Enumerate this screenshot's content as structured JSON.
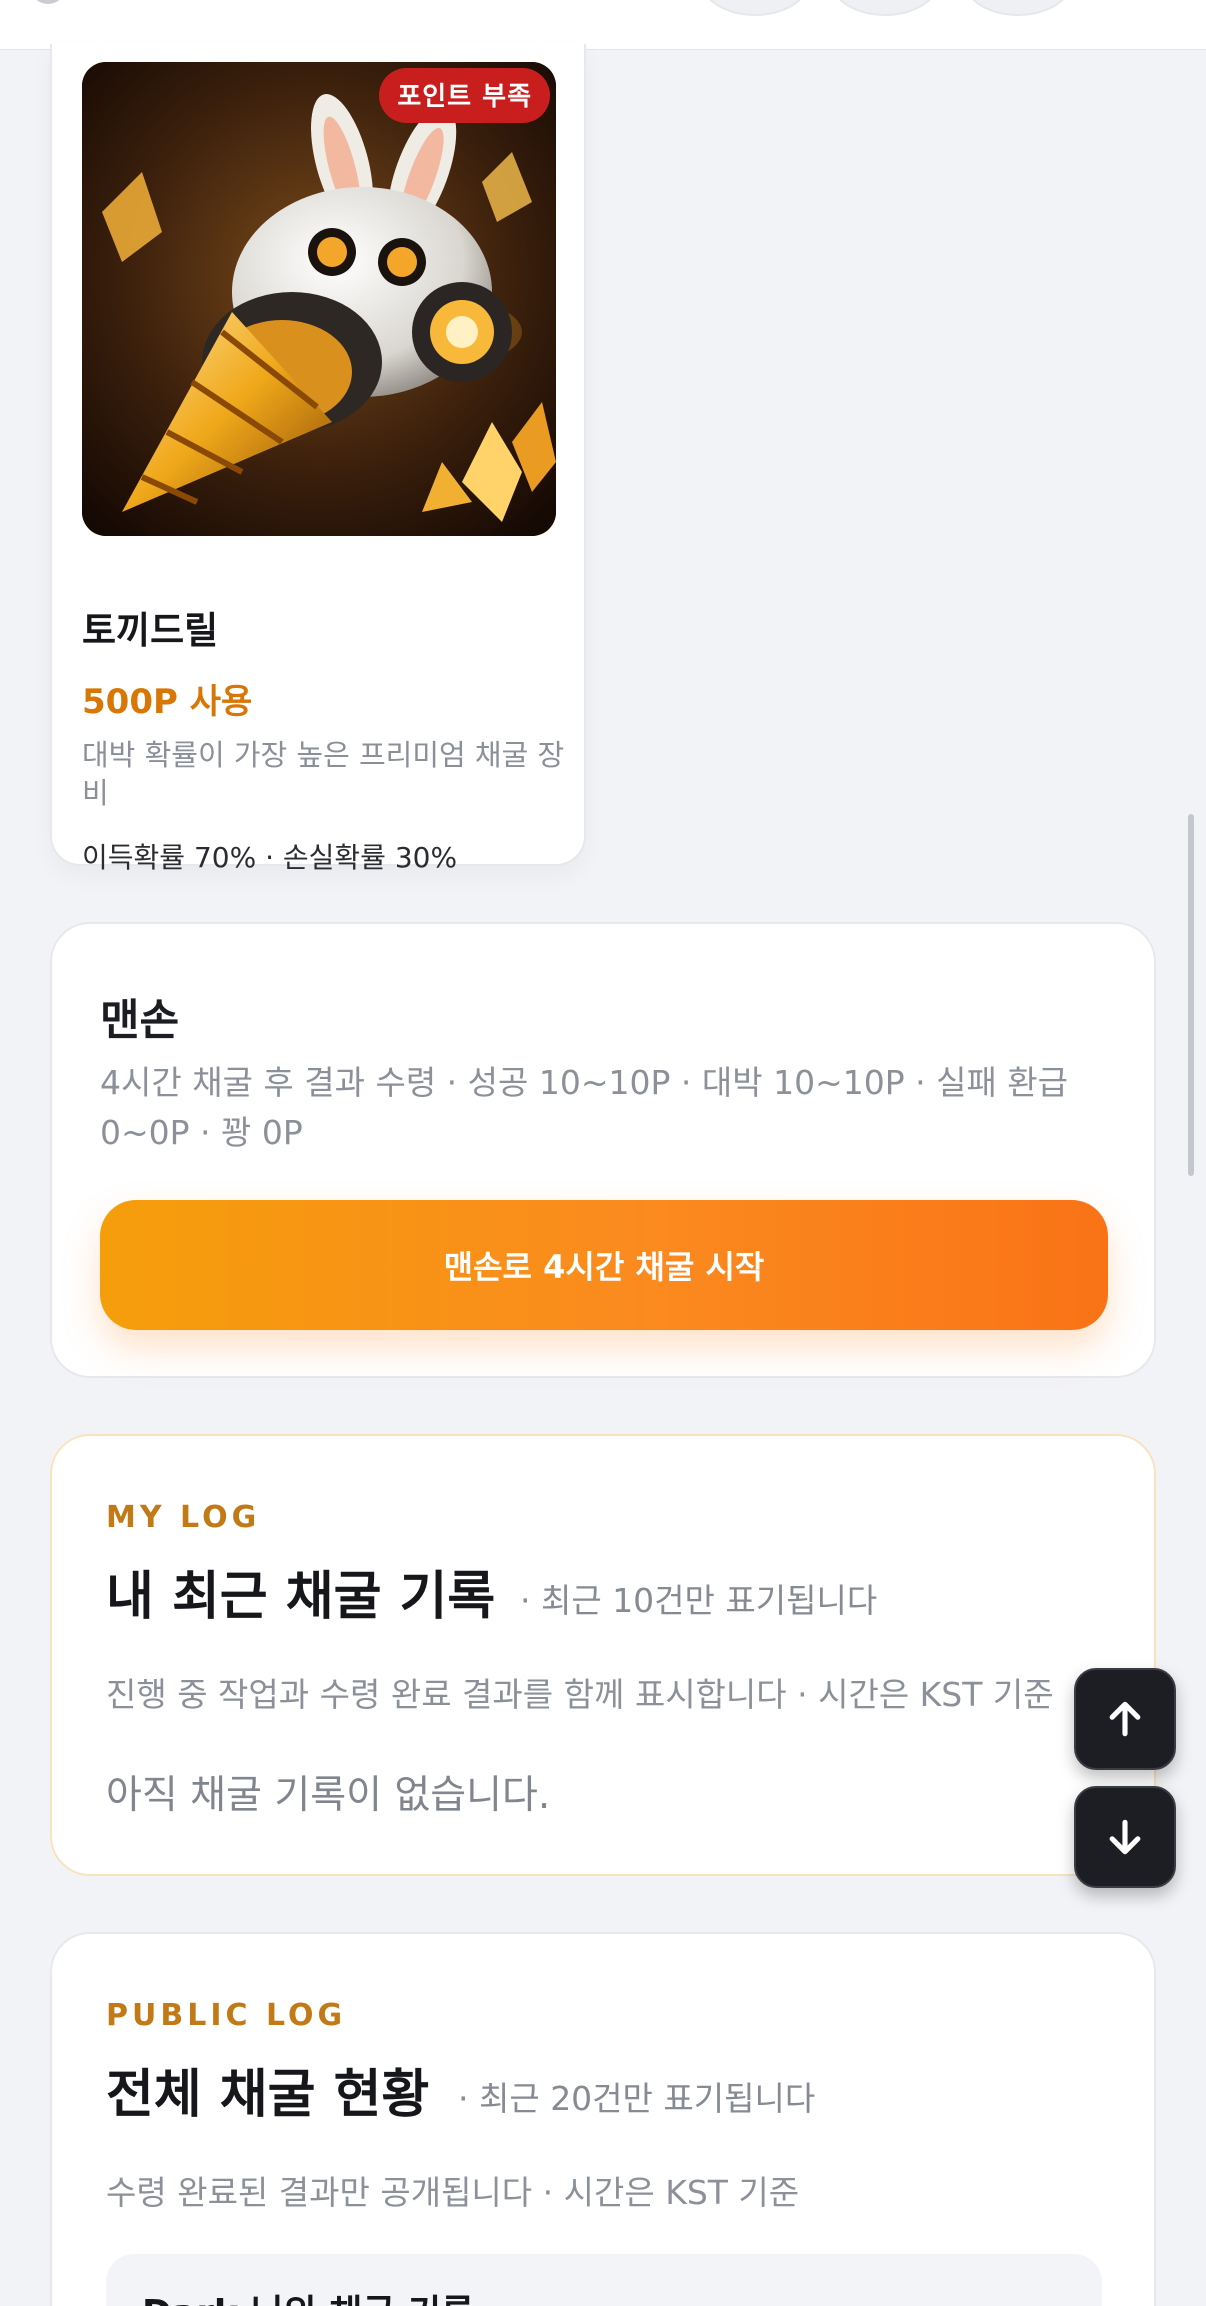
{
  "item": {
    "badge": "포인트 부족",
    "name": "토끼드릴",
    "price": "500P 사용",
    "description": "대박 확률이 가장 높은 프리미엄 채굴 장비",
    "odds": "이득확률 70% · 손실확률 30%"
  },
  "barehand": {
    "title": "맨손",
    "description": "4시간 채굴 후 결과 수령 · 성공 10~10P · 대박 10~10P · 실패 환급 0~0P · 꽝 0P",
    "button_label": "맨손로 4시간 채굴 시작"
  },
  "my_log": {
    "eyebrow": "MY LOG",
    "title": "내 최근 채굴 기록",
    "subtitle": "· 최근 10건만 표기됩니다",
    "note": "진행 중 작업과 수령 완료 결과를 함께 표시합니다 · 시간은 KST 기준",
    "empty_message": "아직 채굴 기록이 없습니다."
  },
  "public_log": {
    "eyebrow": "PUBLIC LOG",
    "title": "전체 채굴 현황",
    "subtitle": "· 최근 20건만 표기됩니다",
    "note": "수령 완료된 결과만 공개됩니다 · 시간은 KST 기준",
    "first_entry": "Dark 님의 채굴 기록"
  },
  "icons": {
    "scroll_up": "arrow-up-icon",
    "scroll_down": "arrow-down-icon"
  },
  "colors": {
    "accent_orange": "#f97316",
    "price_orange": "#d97706",
    "badge_red": "#c81e1e",
    "eyebrow": "#c27a17"
  }
}
